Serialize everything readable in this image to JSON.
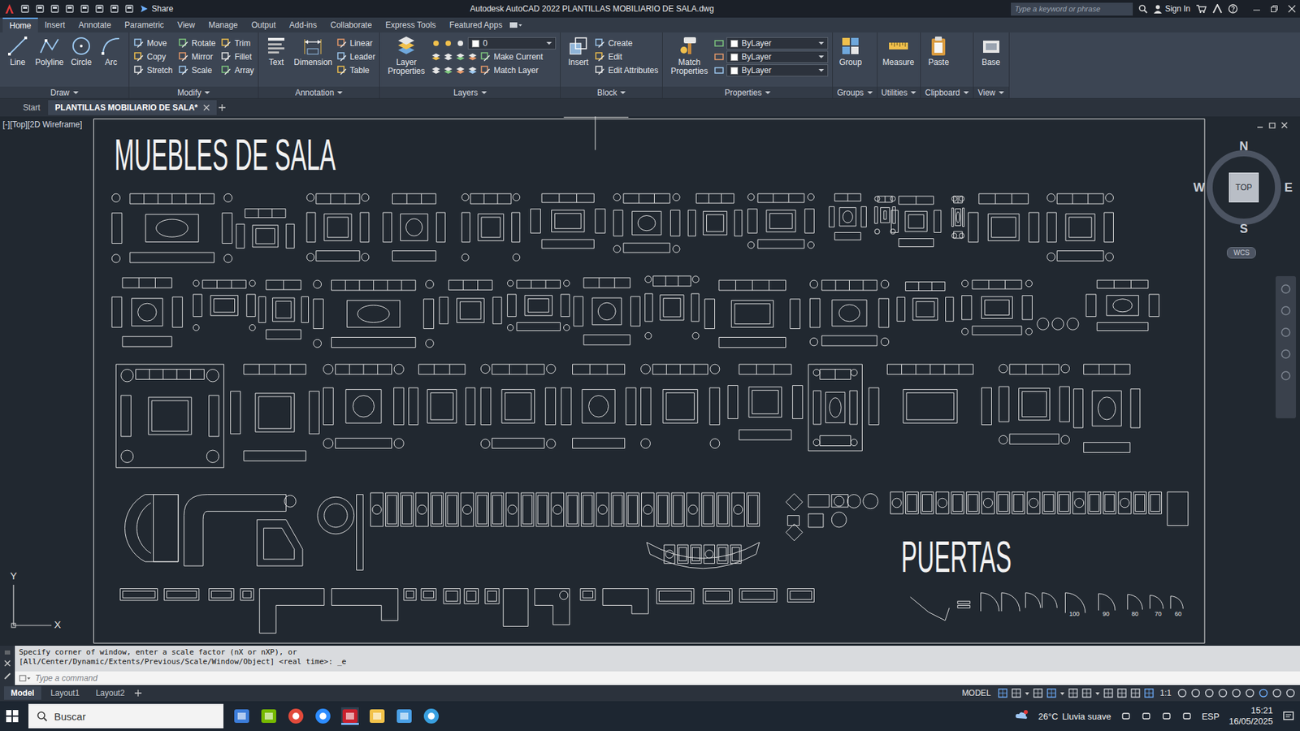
{
  "window": {
    "title": "Autodesk AutoCAD 2022   PLANTILLAS MOBILIARIO DE SALA.dwg",
    "share": "Share",
    "search_placeholder": "Type a keyword or phrase",
    "sign_in": "Sign In"
  },
  "ribbon_tabs": [
    {
      "label": "Home",
      "selected": true
    },
    {
      "label": "Insert",
      "selected": false
    },
    {
      "label": "Annotate",
      "selected": false
    },
    {
      "label": "Parametric",
      "selected": false
    },
    {
      "label": "View",
      "selected": false
    },
    {
      "label": "Manage",
      "selected": false
    },
    {
      "label": "Output",
      "selected": false
    },
    {
      "label": "Add-ins",
      "selected": false
    },
    {
      "label": "Collaborate",
      "selected": false
    },
    {
      "label": "Express Tools",
      "selected": false
    },
    {
      "label": "Featured Apps",
      "selected": false
    }
  ],
  "panels": [
    {
      "label": "Draw",
      "big": [
        "Line",
        "Polyline",
        "Circle",
        "Arc"
      ],
      "small": []
    },
    {
      "label": "Modify",
      "big": [],
      "small": [
        {
          "label": "Move",
          "kind": "button"
        },
        {
          "label": "Copy",
          "kind": "button"
        },
        {
          "label": "Stretch",
          "kind": "button"
        },
        {
          "label": "Rotate",
          "kind": "button"
        },
        {
          "label": "Mirror",
          "kind": "button"
        },
        {
          "label": "Scale",
          "kind": "button"
        },
        {
          "label": "Trim",
          "kind": "button"
        },
        {
          "label": "Fillet",
          "kind": "button"
        },
        {
          "label": "Array",
          "kind": "button"
        }
      ]
    },
    {
      "label": "Annotation",
      "big": [
        "Text",
        "Dimension"
      ],
      "small": [
        {
          "label": "Linear",
          "kind": "button"
        },
        {
          "label": "Leader",
          "kind": "button"
        },
        {
          "label": "Table",
          "kind": "button"
        }
      ]
    },
    {
      "label": "Layers",
      "big": [
        "Layer Properties"
      ],
      "small": [
        {
          "label": "0",
          "kind": "dropdown"
        },
        {
          "label": "Make Current",
          "kind": "button"
        },
        {
          "label": "Match Layer",
          "kind": "button"
        }
      ]
    },
    {
      "label": "Block",
      "big": [
        "Insert"
      ],
      "small": [
        {
          "label": "Create",
          "kind": "button"
        },
        {
          "label": "Edit",
          "kind": "button"
        },
        {
          "label": "Edit Attributes",
          "kind": "button"
        }
      ]
    },
    {
      "label": "Properties",
      "big": [
        "Match Properties"
      ],
      "small": [
        {
          "label": "ByLayer",
          "kind": "dropdown"
        },
        {
          "label": "ByLayer",
          "kind": "dropdown"
        },
        {
          "label": "ByLayer",
          "kind": "dropdown"
        }
      ]
    },
    {
      "label": "Groups",
      "big": [
        "Group"
      ],
      "small": []
    },
    {
      "label": "Utilities",
      "big": [
        "Measure"
      ],
      "small": []
    },
    {
      "label": "Clipboard",
      "big": [
        "Paste"
      ],
      "small": []
    },
    {
      "label": "View",
      "big": [
        "Base"
      ],
      "small": []
    }
  ],
  "file_tabs": [
    {
      "label": "Start",
      "selected": false
    },
    {
      "label": "PLANTILLAS MOBILIARIO DE SALA*",
      "selected": true
    }
  ],
  "viewport": {
    "label": "[-][Top][2D Wireframe]",
    "titles": [
      "MUEBLES DE SALA",
      "PUERTAS"
    ],
    "door_labels": [
      "100",
      "90",
      "80",
      "70",
      "60"
    ],
    "axes": {
      "y": "Y",
      "x": "X"
    }
  },
  "viewcube": {
    "north": "N",
    "south": "S",
    "east": "E",
    "west": "W",
    "face": "TOP",
    "ucs": "WCS"
  },
  "command": {
    "history": [
      "Specify corner of window, enter a scale factor (nX or nXP), or",
      "[All/Center/Dynamic/Extents/Previous/Scale/Window/Object] <real time>: _e"
    ],
    "placeholder": "Type a command"
  },
  "layout_tabs": [
    {
      "label": "Model",
      "selected": true
    },
    {
      "label": "Layout1",
      "selected": false
    },
    {
      "label": "Layout2",
      "selected": false
    }
  ],
  "status_bar": {
    "space": "MODEL",
    "scale": "1:1"
  },
  "taskbar": {
    "search": "Buscar",
    "temperature": "26°C",
    "weather": "Lluvia suave",
    "language": "ESP",
    "time": "15:21",
    "date": "16/05/2025"
  }
}
